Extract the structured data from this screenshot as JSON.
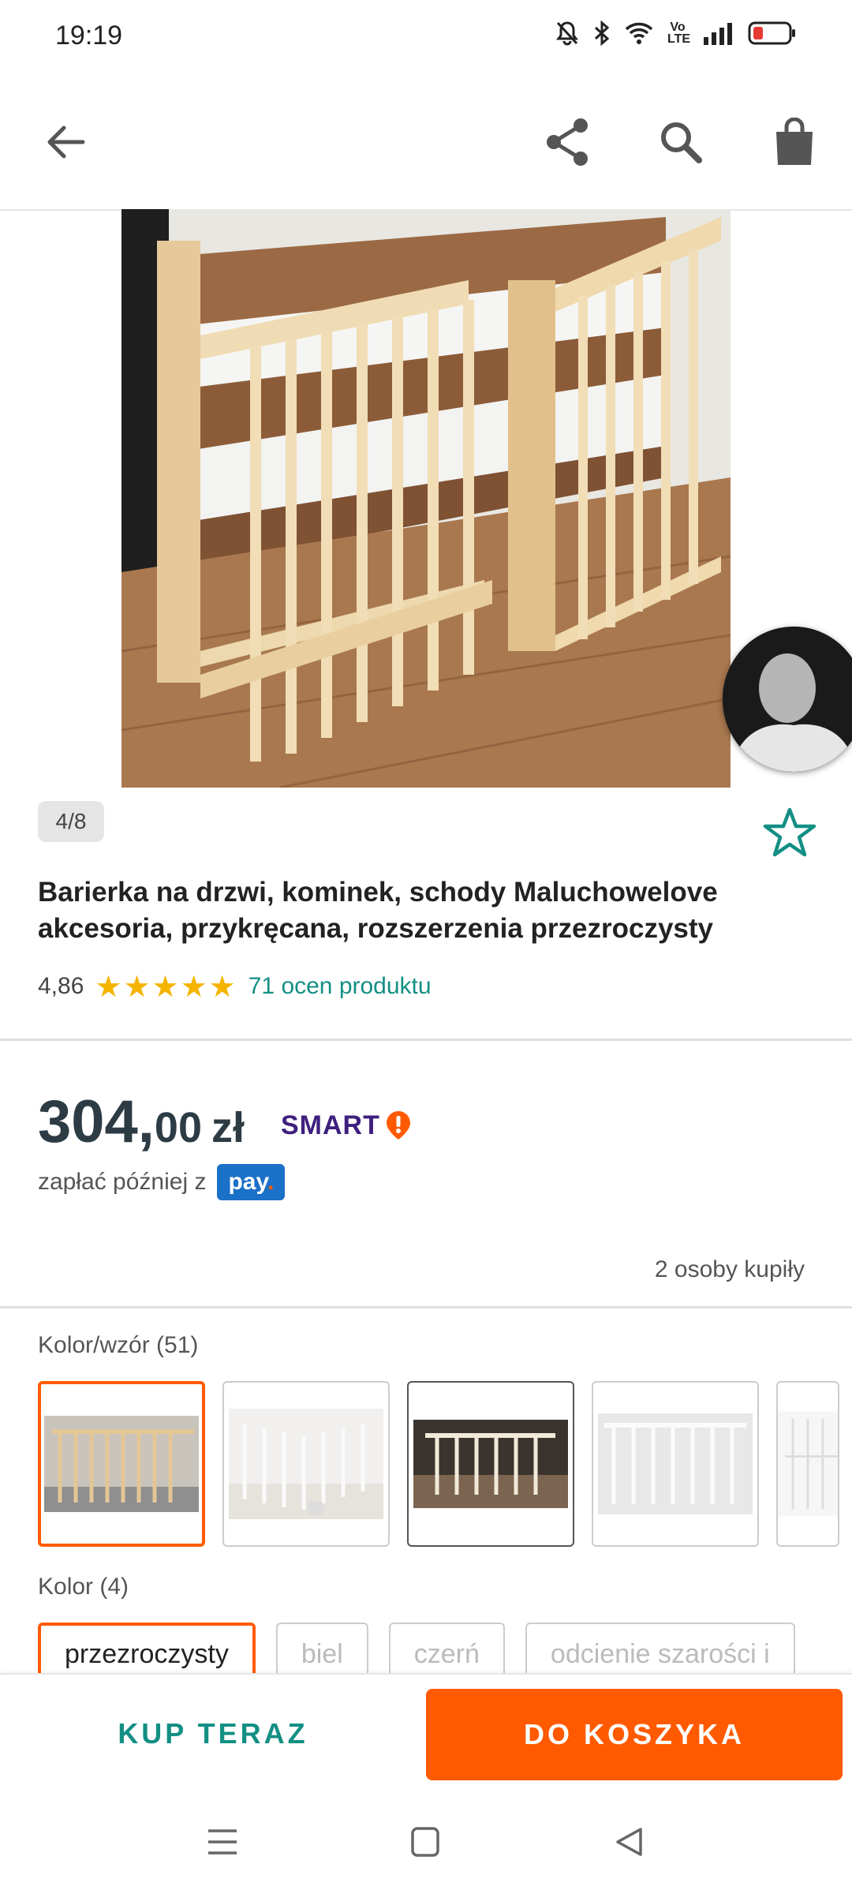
{
  "status_bar": {
    "time": "19:19",
    "icons": [
      "bell-off-icon",
      "bluetooth-icon",
      "wifi-icon",
      "volte-icon",
      "signal-icon",
      "battery-low-icon"
    ],
    "volte_label": "Vo LTE"
  },
  "top_bar": {
    "icons": [
      "back-arrow-icon",
      "share-icon",
      "search-icon",
      "shopping-bag-icon"
    ]
  },
  "gallery": {
    "counter": "4/8"
  },
  "product": {
    "title": "Barierka na drzwi, kominek, schody Maluchowelove akcesoria, przykręcana, rozszerzenia przezroczysty",
    "rating": "4,86",
    "rating_value": 4.86,
    "reviews": "71 ocen produktu"
  },
  "price": {
    "main": "304,",
    "decimals": "00",
    "currency": "zł",
    "smart_label": "SMART",
    "pay_later": "zapłać później z",
    "pay_badge": "pay",
    "bought": "2 osoby kupiły"
  },
  "variants": {
    "color_pattern_label": "Kolor/wzór (51)",
    "color_label": "Kolor (4)",
    "color_chips": [
      "przezroczysty",
      "biel",
      "czerń",
      "odcienie szarości i"
    ]
  },
  "actions": {
    "buy_now": "KUP TERAZ",
    "add_to_cart": "DO KOSZYKA"
  },
  "colors": {
    "accent_orange": "#ff5a00",
    "accent_teal": "#138f84",
    "star": "#f4b400",
    "smart_purple": "#3e1f7e",
    "pay_blue": "#1b70c8"
  }
}
